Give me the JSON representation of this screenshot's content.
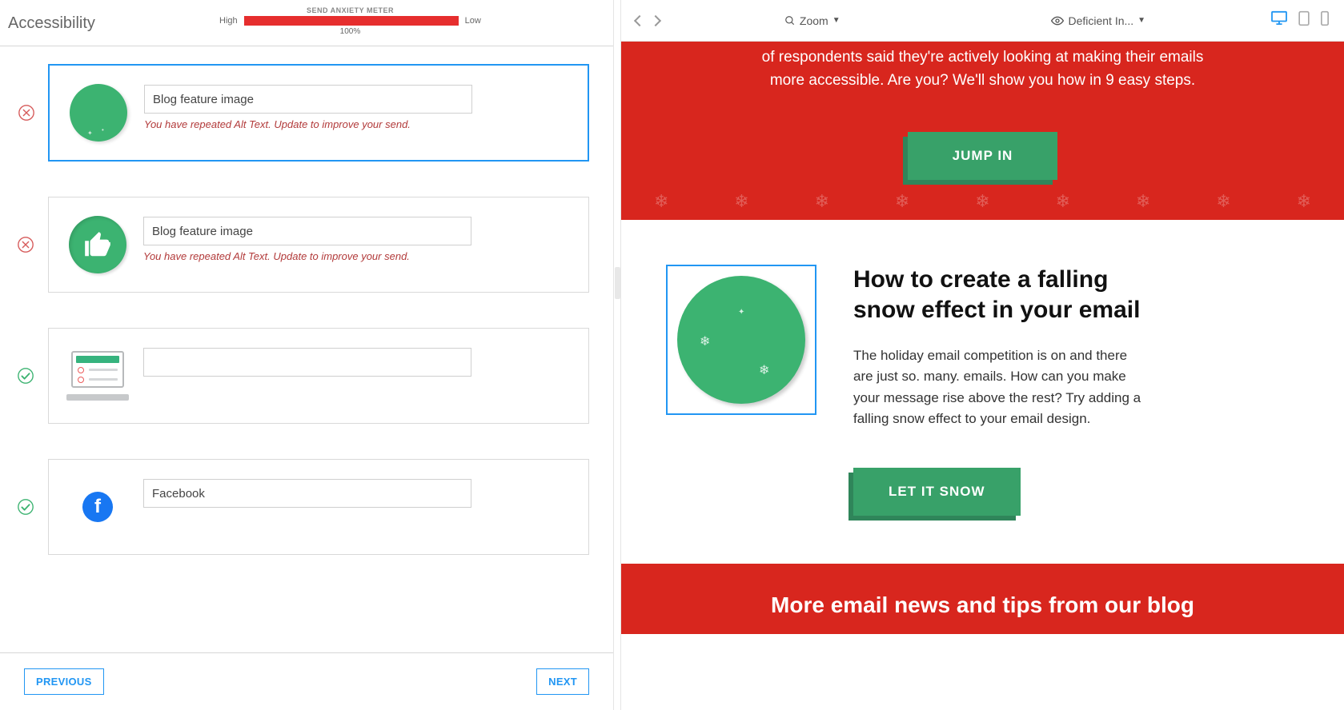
{
  "left": {
    "title": "Accessibility",
    "meter": {
      "label": "SEND ANXIETY METER",
      "high": "High",
      "low": "Low",
      "percent": "100%"
    },
    "items": [
      {
        "status": "error",
        "thumb": "snow-circle",
        "value": "Blog feature image",
        "error": "You have repeated Alt Text. Update to improve your send."
      },
      {
        "status": "error",
        "thumb": "thumbs-up",
        "value": "Blog feature image",
        "error": "You have repeated Alt Text. Update to improve your send."
      },
      {
        "status": "ok",
        "thumb": "laptop",
        "value": "",
        "error": ""
      },
      {
        "status": "ok",
        "thumb": "facebook",
        "value": "Facebook",
        "error": ""
      }
    ],
    "footer": {
      "prev": "PREVIOUS",
      "next": "NEXT"
    }
  },
  "right": {
    "toolbar": {
      "zoom": "Zoom",
      "filter": "Deficient In..."
    },
    "hero": {
      "text": "of respondents said they're actively looking at making their emails more accessible. Are you? We'll show you how in 9 easy steps.",
      "cta": "JUMP IN"
    },
    "article": {
      "title": "How to create a falling snow effect in your email",
      "body": "The holiday email competition is on and there are just so. many. emails. How can you make your message rise above the rest? Try adding a falling snow effect to your email design.",
      "cta": "LET IT SNOW"
    },
    "blog_band": "More email news and tips from our blog"
  }
}
